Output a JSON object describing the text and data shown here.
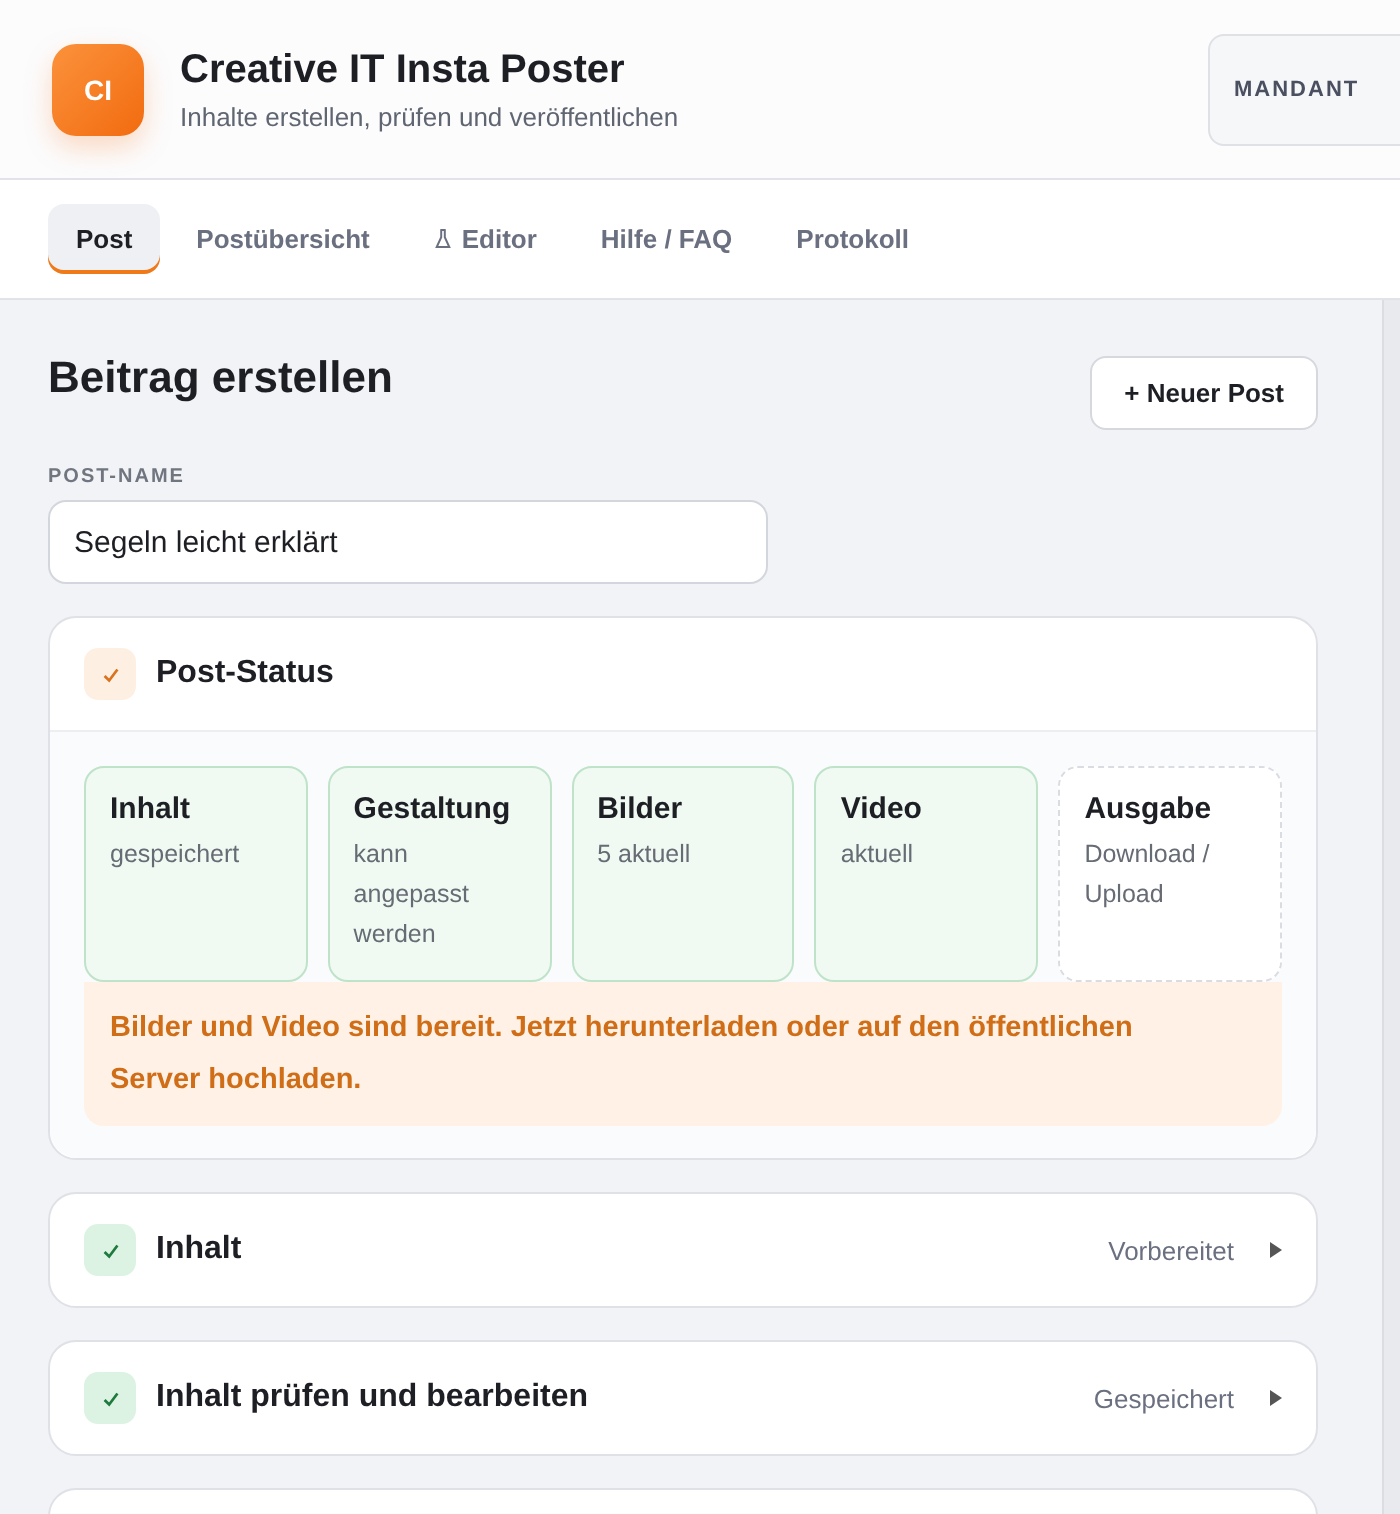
{
  "app": {
    "logo": "CI",
    "title": "Creative IT Insta Poster",
    "subtitle": "Inhalte erstellen, prüfen und veröffentlichen",
    "tenant_button": "MANDANT"
  },
  "tabs": [
    {
      "label": "Post",
      "selected": true,
      "kind": "text"
    },
    {
      "label": "Postübersicht",
      "selected": false,
      "kind": "text"
    },
    {
      "label": "Editor",
      "selected": false,
      "kind": "lab"
    },
    {
      "label": "Hilfe / FAQ",
      "selected": false,
      "kind": "text"
    },
    {
      "label": "Protokoll",
      "selected": false,
      "kind": "text"
    }
  ],
  "page": {
    "title": "Beitrag erstellen",
    "new_button": "+ Neuer Post",
    "name_label": "POST-NAME",
    "name_value": "Segeln leicht erklärt"
  },
  "post_status": {
    "title": "Post-Status",
    "done": true,
    "steps": [
      {
        "title": "Inhalt",
        "detail": "gespeichert",
        "done": true
      },
      {
        "title": "Gestaltung",
        "detail": "kann angepasst werden",
        "done": true
      },
      {
        "title": "Bilder",
        "detail": "5 aktuell",
        "done": true
      },
      {
        "title": "Video",
        "detail": "aktuell",
        "done": true
      },
      {
        "title": "Ausgabe",
        "detail": "Download / Upload",
        "done": false
      }
    ],
    "notice": "Bilder und Video sind bereit. Jetzt herunterladen oder auf den öffentlichen Server hochladen."
  },
  "sections": [
    {
      "title": "Inhalt",
      "status": "Vorbereitet",
      "done": true
    },
    {
      "title": "Inhalt prüfen und bearbeiten",
      "status": "Gespeichert",
      "done": true
    }
  ]
}
